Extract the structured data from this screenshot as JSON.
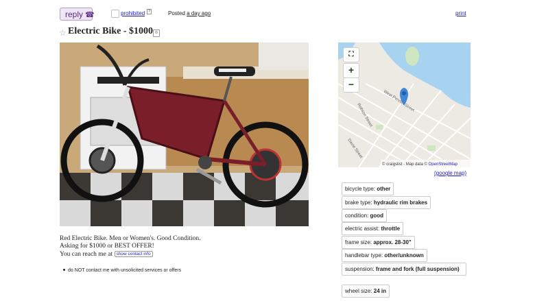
{
  "header": {
    "reply_label": "reply",
    "reply_icon": "phone-icon",
    "prohibited_label": "prohibited",
    "help_label": "?",
    "posted_label": "Posted",
    "posted_when": "a day ago",
    "print_label": "print"
  },
  "listing": {
    "title": "Electric Bike - $1000",
    "star_icon": "star-icon",
    "hide_icon": "hide-icon"
  },
  "map": {
    "zoom_in": "+",
    "zoom_out": "−",
    "fullscreen_icon": "fullscreen-icon",
    "attribution_prefix": "© craigslist - Map data © ",
    "attribution_link": "OpenStreetMap",
    "google_map_label": "(google map)",
    "street_labels": [
      "West Pender Street",
      "Robson Street",
      "Davie Street"
    ]
  },
  "description": {
    "line1": "Red Electric Bike. Men or Women's. Good Condition.",
    "line2": "Asking for $1000 or BEST OFFER!",
    "line3": "You can reach me at",
    "contact_button": "show contact info"
  },
  "notice": "do NOT contact me with unsolicited services or offers",
  "attributes": [
    {
      "label": "bicycle type: ",
      "value": "other"
    },
    {
      "label": "brake type: ",
      "value": "hydraulic rim brakes"
    },
    {
      "label": "condition: ",
      "value": "good"
    },
    {
      "label": "electric assist: ",
      "value": "throttle"
    },
    {
      "label": "frame size: ",
      "value": "approx. 28-30\""
    },
    {
      "label": "handlebar type: ",
      "value": "other/unknown"
    },
    {
      "label": "suspension: ",
      "value": "frame and fork (full suspension)"
    },
    {
      "label": "wheel size: ",
      "value": "24 in"
    }
  ],
  "colors": {
    "reply_bg": "#eee6f5",
    "reply_border": "#b79ad0",
    "link": "#1a1ac4",
    "water": "#a8d3f0",
    "pin": "#3d87d6",
    "bike_frame": "#7a1f2a"
  }
}
